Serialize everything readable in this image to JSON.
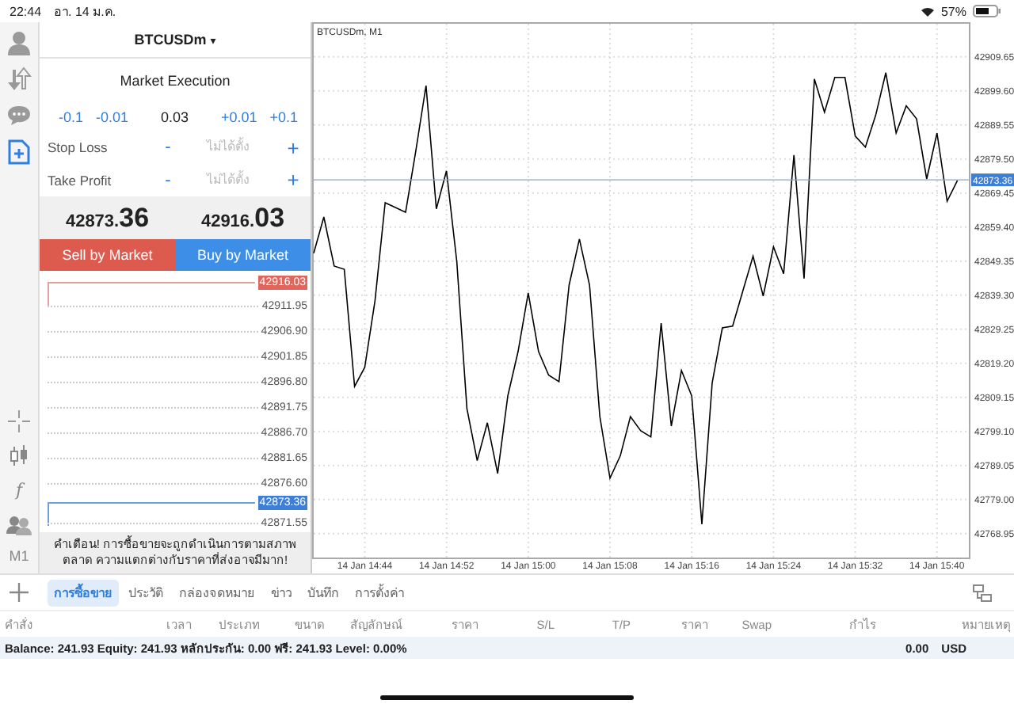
{
  "status_bar": {
    "time": "22:44",
    "date": "อา. 14 ม.ค.",
    "battery": "57%"
  },
  "rail": {
    "items": [
      {
        "kind": "person",
        "selected": false
      },
      {
        "kind": "transfer",
        "selected": false
      },
      {
        "kind": "chat",
        "selected": false
      },
      {
        "kind": "new-order",
        "selected": true
      }
    ],
    "tools": [
      {
        "kind": "crosshair"
      },
      {
        "kind": "candles"
      },
      {
        "kind": "glyph",
        "label": "f"
      },
      {
        "kind": "people"
      },
      {
        "kind": "glyph",
        "label": "M1"
      }
    ]
  },
  "order_panel": {
    "symbol": "BTCUSDm",
    "symbol_caret": "▾",
    "mode": "Market Execution",
    "volume": {
      "decrease": [
        "-0.1",
        "-0.01"
      ],
      "value": "0.03",
      "increase": [
        "+0.01",
        "+0.1"
      ]
    },
    "limits": [
      {
        "label": "Stop Loss",
        "minus": "-",
        "placeholder": "ไม่ได้ตั้ง",
        "plus": "+"
      },
      {
        "label": "Take Profit",
        "minus": "-",
        "placeholder": "ไม่ได้ตั้ง",
        "plus": "+"
      }
    ],
    "bid": {
      "lead": "42873.",
      "pips": "36"
    },
    "ask": {
      "lead": "42916.",
      "pips": "03"
    },
    "buttons": [
      {
        "kind": "sell",
        "label": "Sell by Market"
      },
      {
        "kind": "buy",
        "label": "Buy by Market"
      }
    ],
    "ladder": [
      {
        "kind": "ask",
        "price": "42916.03"
      },
      {
        "kind": "level",
        "price": "42911.95"
      },
      {
        "kind": "level",
        "price": "42906.90"
      },
      {
        "kind": "level",
        "price": "42901.85"
      },
      {
        "kind": "level",
        "price": "42896.80"
      },
      {
        "kind": "level",
        "price": "42891.75"
      },
      {
        "kind": "level",
        "price": "42886.70"
      },
      {
        "kind": "level",
        "price": "42881.65"
      },
      {
        "kind": "level",
        "price": "42876.60"
      },
      {
        "kind": "bid",
        "price": "42873.36"
      },
      {
        "kind": "level",
        "price": "42871.55"
      }
    ],
    "warning": "คำเตือน! การซื้อขายจะถูกดำเนินการตามสภาพตลาด ความแตกต่างกับราคาที่ส่งอาจมีมาก!"
  },
  "chart": {
    "chart_data": {
      "type": "line",
      "title": "BTCUSDm, M1",
      "categories": [
        null,
        null,
        null,
        null,
        null,
        "14 Jan 14:44",
        null,
        null,
        null,
        null,
        null,
        null,
        null,
        "14 Jan 14:52",
        null,
        null,
        null,
        null,
        null,
        null,
        null,
        "14 Jan 15:00",
        null,
        null,
        null,
        null,
        null,
        null,
        null,
        "14 Jan 15:08",
        null,
        null,
        null,
        null,
        null,
        null,
        null,
        "14 Jan 15:16",
        null,
        null,
        null,
        null,
        null,
        null,
        null,
        "14 Jan 15:24",
        null,
        null,
        null,
        null,
        null,
        null,
        null,
        "14 Jan 15:32",
        null,
        null,
        null,
        null,
        null,
        null,
        null,
        "14 Jan 15:40",
        null,
        null
      ],
      "series": [
        {
          "color": "#000000",
          "values": [
            42851.7,
            42862.4,
            42847.9,
            42847.0,
            42812.4,
            42818.0,
            42837.7,
            42866.6,
            42865.2,
            42863.8,
            42882.1,
            42901.2,
            42864.8,
            42876.0,
            42849.3,
            42805.9,
            42790.5,
            42801.7,
            42786.7,
            42809.6,
            42822.7,
            42840.0,
            42822.7,
            42815.7,
            42813.8,
            42842.3,
            42855.9,
            42842.3,
            42803.5,
            42785.3,
            42791.9,
            42803.5,
            42799.3,
            42797.5,
            42831.1,
            42800.7,
            42817.1,
            42809.6,
            42771.7,
            42813.4,
            42829.7,
            42830.2,
            42840.5,
            42850.8,
            42839.1,
            42853.6,
            42845.6,
            42880.7,
            42844.2,
            42903.1,
            42893.3,
            42903.6,
            42903.6,
            42886.3,
            42883.0,
            42892.4,
            42905.0,
            42887.2,
            42895.2,
            42891.4,
            42873.6,
            42887.2,
            42867.1,
            42873.2
          ]
        }
      ],
      "ylim": [
        42761.9,
        42919.9
      ],
      "yticks": [
        {
          "value": 42768.95,
          "label": "42768.95"
        },
        {
          "value": 42779.0,
          "label": "42779.00"
        },
        {
          "value": 42789.05,
          "label": "42789.05"
        },
        {
          "value": 42799.1,
          "label": "42799.10"
        },
        {
          "value": 42809.15,
          "label": "42809.15"
        },
        {
          "value": 42819.2,
          "label": "42819.20"
        },
        {
          "value": 42829.25,
          "label": "42829.25"
        },
        {
          "value": 42839.3,
          "label": "42839.30"
        },
        {
          "value": 42849.35,
          "label": "42849.35"
        },
        {
          "value": 42859.4,
          "label": "42859.40"
        },
        {
          "value": 42869.45,
          "label": "42869.45"
        },
        {
          "value": 42879.5,
          "label": "42879.50"
        },
        {
          "value": 42889.55,
          "label": "42889.55"
        },
        {
          "value": 42899.6,
          "label": "42899.60"
        },
        {
          "value": 42909.65,
          "label": "42909.65"
        }
      ],
      "grid": true,
      "ref_lines": [
        {
          "axis": "y",
          "value": 42873.36,
          "label": "42873.36",
          "color": "#8aa8c8"
        }
      ]
    }
  },
  "tabs": [
    {
      "label": "การซื้อขาย",
      "selected": true
    },
    {
      "label": "ประวัติ",
      "selected": false
    },
    {
      "label": "กล่องจดหมาย",
      "selected": false
    },
    {
      "label": "ข่าว",
      "selected": false
    },
    {
      "label": "บันทึก",
      "selected": false
    },
    {
      "label": "การตั้งค่า",
      "selected": false
    }
  ],
  "table": {
    "columns": [
      "คำสั่ง",
      "เวลา",
      "ประเภท",
      "ขนาด",
      "สัญลักษณ์",
      "ราคา",
      "S/L",
      "T/P",
      "ราคา",
      "Swap",
      "กำไร",
      "หมายเหตุ"
    ]
  },
  "summary": {
    "text": "Balance: 241.93 Equity: 241.93 หลักประกัน: 0.00 ฟรี: 241.93 Level: 0.00%",
    "profit": "0.00",
    "currency": "USD"
  }
}
